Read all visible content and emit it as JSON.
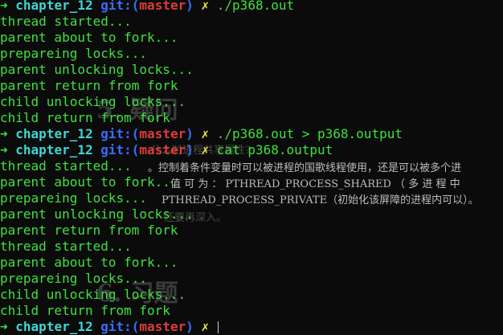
{
  "terminal": {
    "prompt": {
      "arrow": "➜",
      "dir": "chapter_12",
      "git_prefix": "git:(",
      "branch": "master",
      "git_suffix": ")",
      "dirty": "✗"
    },
    "lines": [
      {
        "kind": "prompt",
        "command": "./p368.out"
      },
      {
        "kind": "output",
        "text": "thread started..."
      },
      {
        "kind": "output",
        "text": "parent about to fork..."
      },
      {
        "kind": "output",
        "text": "prepareing locks..."
      },
      {
        "kind": "output",
        "text": "parent unlocking locks..."
      },
      {
        "kind": "output",
        "text": "parent return from fork"
      },
      {
        "kind": "output",
        "text": "child unlocking locks..."
      },
      {
        "kind": "output",
        "text": "child return from fork"
      },
      {
        "kind": "prompt",
        "command": "./p368.out > p368.output"
      },
      {
        "kind": "prompt",
        "command": "cat p368.output"
      },
      {
        "kind": "output",
        "text": "thread started..."
      },
      {
        "kind": "output",
        "text": "parent about to fork..."
      },
      {
        "kind": "output",
        "text": "prepareing locks..."
      },
      {
        "kind": "output",
        "text": "parent unlocking locks..."
      },
      {
        "kind": "output",
        "text": "parent return from fork"
      },
      {
        "kind": "output",
        "text": "thread started..."
      },
      {
        "kind": "output",
        "text": "parent about to fork..."
      },
      {
        "kind": "output",
        "text": "prepareing locks..."
      },
      {
        "kind": "output",
        "text": "child unlocking locks..."
      },
      {
        "kind": "output",
        "text": "child return from fork"
      },
      {
        "kind": "prompt",
        "command": ""
      }
    ]
  },
  "background_document": {
    "heading1": "5. 疑问",
    "question": "什么时进程共享属性?",
    "para1": "。控制着条件变量时可以被进程的国歌线程使用，还是可以被多个进",
    "para2": "值 可 为 ： PTHREAD_PROCESS_SHARED （ 多 进 程 中",
    "para3": "PTHREAD_PROCESS_PRIVATE（初始化该屏障的进程内可以）。",
    "para4": "还要再深入。",
    "heading2": "6. 习题"
  }
}
